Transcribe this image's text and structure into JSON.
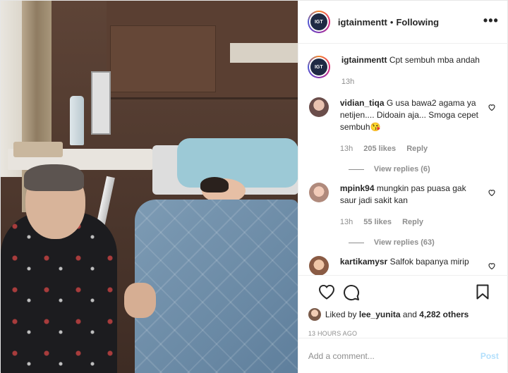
{
  "post": {
    "username": "igtainmentt",
    "follow_status": "Following",
    "more_icon": "more-horizontal-icon",
    "logo_text": "IGT"
  },
  "caption": {
    "username": "igtainmentt",
    "text": "Cpt sembuh mba andah",
    "time": "13h"
  },
  "comments": [
    {
      "username": "vidian_tiqa",
      "text": "G usa bawa2 agama ya netijen.... Didoain aja... Smoga cepet sembuh😘",
      "time": "13h",
      "likes": "205 likes",
      "reply_label": "Reply",
      "view_replies": "View replies (6)"
    },
    {
      "username": "mpink94",
      "text": "mungkin pas puasa gak saur jadi sakit kan",
      "time": "13h",
      "likes": "55 likes",
      "reply_label": "Reply",
      "view_replies": "View replies (63)"
    },
    {
      "username": "kartikamysr",
      "text": "Salfok bapanya mirip"
    }
  ],
  "actions": {
    "liked_by_prefix": "Liked by",
    "liked_by_user": "lee_yunita",
    "liked_by_mid": "and",
    "liked_by_count": "4,282 others",
    "timestamp": "13 HOURS AGO"
  },
  "add_comment": {
    "placeholder": "Add a comment...",
    "post_label": "Post"
  },
  "colors": {
    "link_disabled": "#b2dffc",
    "meta_text": "#8e8e8e",
    "border": "#efefef"
  }
}
